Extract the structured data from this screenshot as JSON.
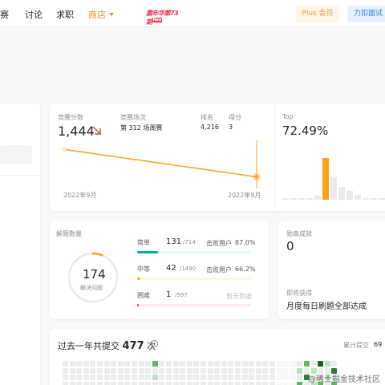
{
  "nav": {
    "items": [
      "赛",
      "讨论",
      "求职"
    ],
    "shop": "商店",
    "promo": "嘉年华第73期",
    "promo_tag": "New",
    "plus": "Plus 会员",
    "interview": "力扣面试"
  },
  "contest": {
    "score_label": "竞赛分数",
    "score": "1,444",
    "round_label": "竞赛场次",
    "round": "第 312 场周赛",
    "rank_label": "排名",
    "rank": "4,216",
    "points_label": "得分",
    "points": "3",
    "x_start": "2022年9月",
    "x_end": "2022年9月"
  },
  "top": {
    "label": "Top",
    "value": "72.49%"
  },
  "chart_data": [
    {
      "type": "line",
      "x": [
        "2022年9月",
        "2022年9月"
      ],
      "values": [
        1500,
        1444
      ],
      "xlabel": "",
      "ylabel": ""
    },
    {
      "type": "bar",
      "title": "Top",
      "values": [
        1,
        1,
        2,
        2,
        10,
        100,
        55,
        30,
        22,
        12,
        5,
        3,
        2
      ],
      "highlight_index": 5
    }
  ],
  "solved": {
    "label": "解题数量",
    "count": "174",
    "count_label": "解决问题",
    "rows": [
      {
        "name": "简单",
        "count": "131",
        "total": "/714",
        "beat_label": "击败用户",
        "beat": "87.0%",
        "fraction": 0.183
      },
      {
        "name": "中等",
        "count": "42",
        "total": "/1490",
        "beat_label": "击败用户",
        "beat": "66.2%",
        "fraction": 0.028
      },
      {
        "name": "困难",
        "count": "1",
        "total": "/597",
        "beat_label": "暂无数据",
        "beat": "",
        "fraction": 0.002
      }
    ]
  },
  "badges": {
    "label": "勋章成就",
    "count": "0",
    "upcoming_label": "即将获得",
    "upcoming": "月度每日刷题全部达成"
  },
  "submissions": {
    "prefix": "过去一年共提交",
    "count": "477",
    "unit": "次",
    "cumulative_label": "累计提交",
    "cumulative": "69"
  },
  "watermark": "@稀土掘金技术社区",
  "colors": {
    "accent_orange": "#ffa116",
    "easy": "#00af9b",
    "medium": "#ffb800",
    "hard": "#ff2d55",
    "link_blue": "#2f80ed",
    "red_arrow": "#ef4743"
  }
}
